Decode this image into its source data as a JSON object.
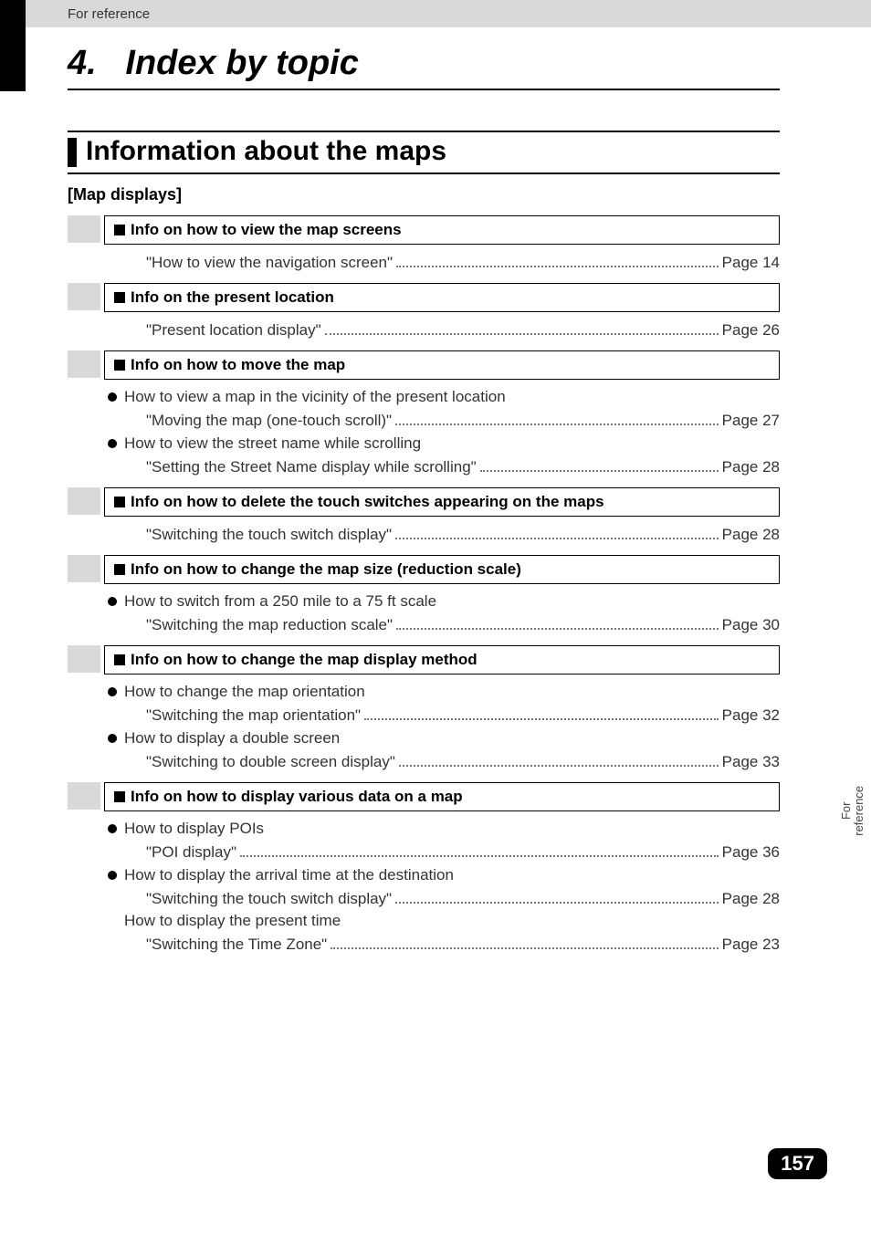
{
  "header": {
    "label": "For reference"
  },
  "chapter": {
    "number": "4.",
    "title": "Index by topic"
  },
  "section": {
    "title": "Information about the maps"
  },
  "subsection": {
    "label": "[Map displays]"
  },
  "entries": [
    {
      "heading": "Info on how to view the map screens",
      "items": [
        {
          "ref": "\"How to view the navigation screen\"",
          "page": "Page 14"
        }
      ]
    },
    {
      "heading": "Info on the present location",
      "items": [
        {
          "ref": "\"Present location display\"",
          "page": "Page 26"
        }
      ]
    },
    {
      "heading": "Info on how to move the map",
      "items": [
        {
          "bullet": "How to view a map in the vicinity of the present location",
          "ref": "\"Moving the map (one-touch scroll)\"",
          "page": "Page 27"
        },
        {
          "bullet": "How to view the street name while scrolling",
          "ref": "\"Setting the Street Name display while scrolling\"",
          "page": "Page 28"
        }
      ]
    },
    {
      "heading": "Info on how to delete the touch switches appearing on the maps",
      "items": [
        {
          "ref": "\"Switching the touch switch display\"",
          "page": "Page 28"
        }
      ]
    },
    {
      "heading": "Info on how to change the map size (reduction scale)",
      "items": [
        {
          "bullet": "How to switch from a 250 mile to a 75 ft scale",
          "ref": "\"Switching the map reduction scale\"",
          "page": "Page 30"
        }
      ]
    },
    {
      "heading": "Info on how to change the map display method",
      "items": [
        {
          "bullet": "How to change the map orientation",
          "ref": "\"Switching the map orientation\"",
          "page": "Page 32"
        },
        {
          "bullet": "How to display a double screen",
          "ref": "\"Switching to double screen display\"",
          "page": "Page 33"
        }
      ]
    },
    {
      "heading": "Info on how to display various data on a map",
      "items": [
        {
          "bullet": "How to display POIs",
          "ref": "\"POI display\"",
          "page": "Page 36"
        },
        {
          "bullet": "How to display the arrival time at the destination",
          "ref": "\"Switching the touch switch display\"",
          "page": "Page 28"
        },
        {
          "plain": "How to display the present time",
          "ref": "\"Switching the Time Zone\"",
          "page": "Page 23"
        }
      ]
    }
  ],
  "sidetab": {
    "label": "For\nreference"
  },
  "pagenum": "157"
}
